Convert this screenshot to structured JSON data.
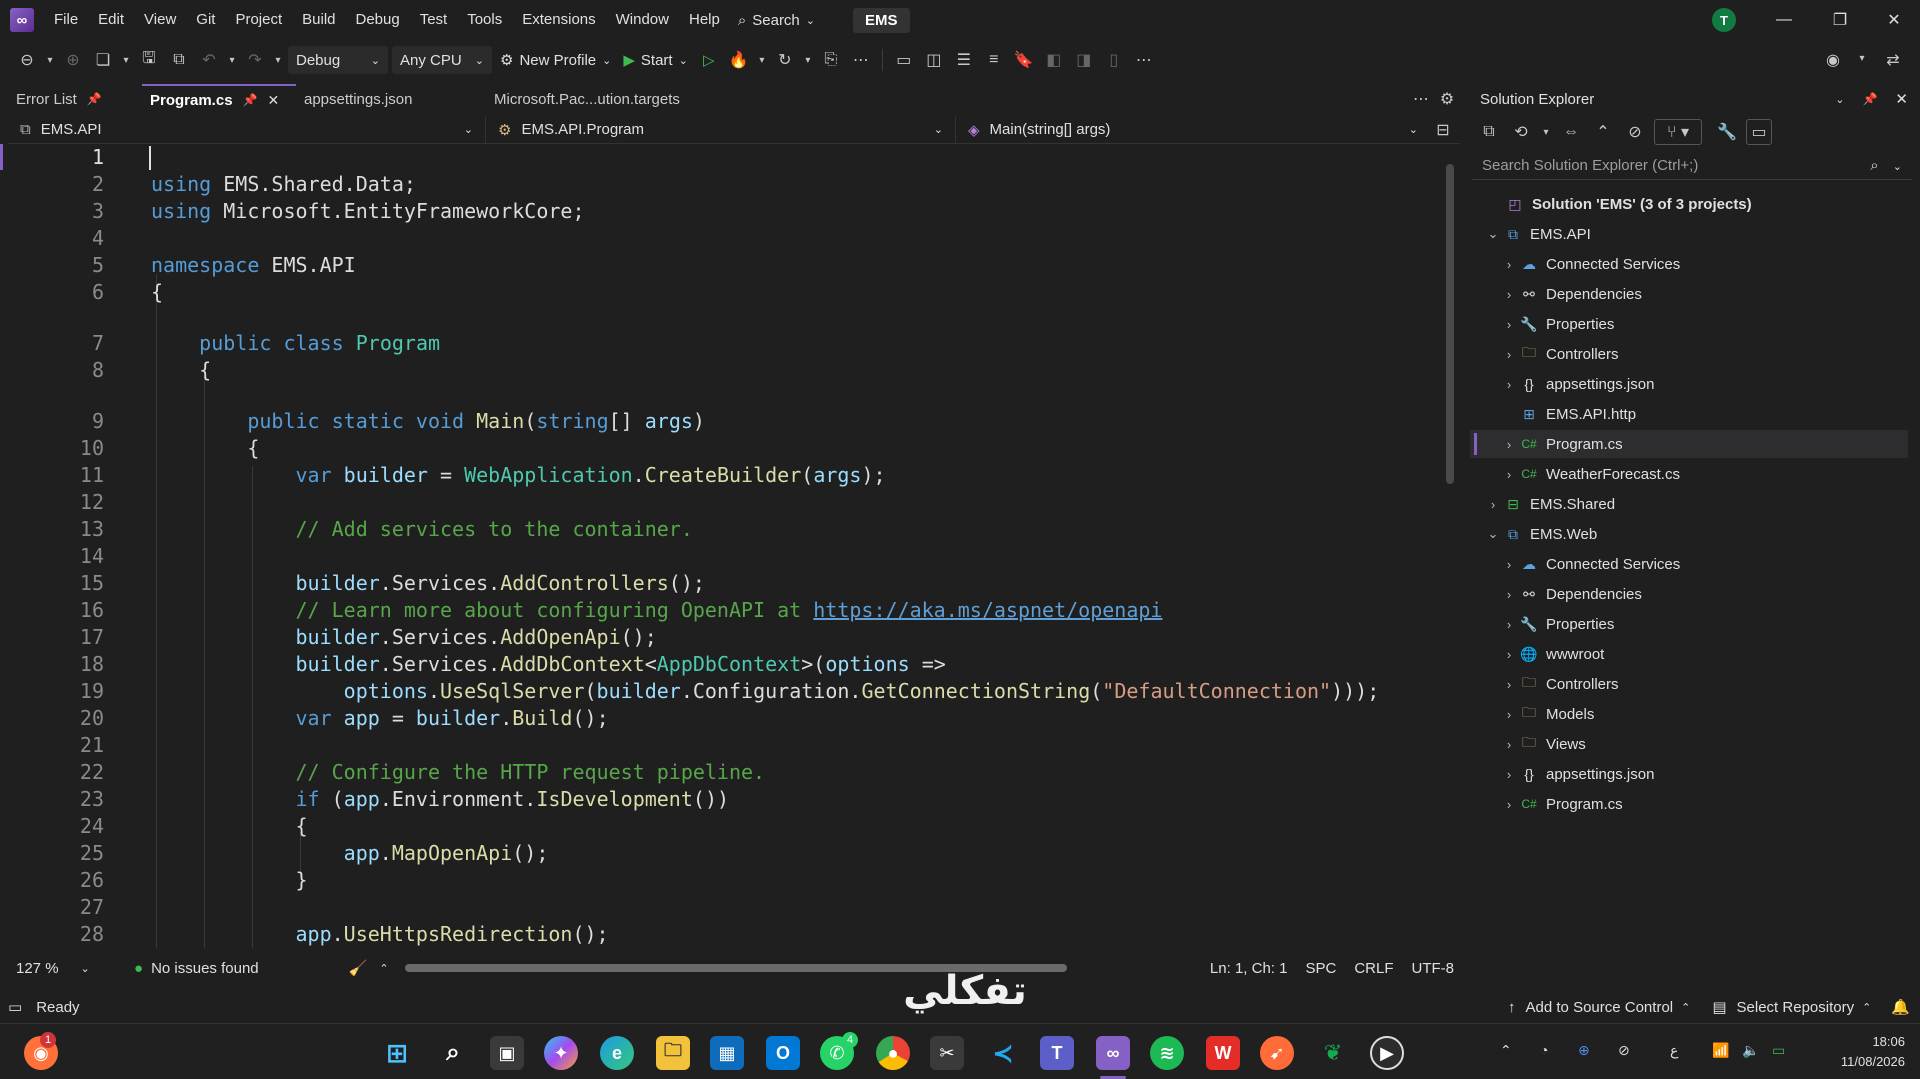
{
  "menubar": {
    "items": [
      "File",
      "Edit",
      "View",
      "Git",
      "Project",
      "Build",
      "Debug",
      "Test",
      "Tools",
      "Extensions",
      "Window",
      "Help"
    ],
    "search_label": "Search",
    "solution_name": "EMS",
    "avatar_initial": "T"
  },
  "toolbar": {
    "config": "Debug",
    "platform": "Any CPU",
    "profile": "New Profile",
    "start": "Start"
  },
  "tabs": {
    "error_list": "Error List",
    "program_cs": "Program.cs",
    "appsettings": "appsettings.json",
    "targets": "Microsoft.Pac...ution.targets"
  },
  "navbar": {
    "project": "EMS.API",
    "class": "EMS.API.Program",
    "member": "Main(string[] args)"
  },
  "editor": {
    "current_line": 1,
    "line_numbers": [
      "1",
      "2",
      "3",
      "4",
      "5",
      "6",
      "7",
      "8",
      "9",
      "10",
      "11",
      "12",
      "13",
      "14",
      "15",
      "16",
      "17",
      "18",
      "19",
      "20",
      "21",
      "22",
      "23",
      "24",
      "25",
      "26",
      "27",
      "28"
    ]
  },
  "editor_status": {
    "zoom": "127 %",
    "issues": "No issues found",
    "position": "Ln: 1, Ch: 1",
    "whitespace": "SPC",
    "line_endings": "CRLF",
    "encoding": "UTF-8"
  },
  "solution_explorer": {
    "title": "Solution Explorer",
    "search_placeholder": "Search Solution Explorer (Ctrl+;)",
    "solution_label": "Solution 'EMS' (3 of 3 projects)",
    "items": [
      {
        "label": "EMS.API",
        "icon": "project-icon"
      },
      {
        "label": "Connected Services",
        "icon": "connected-services-icon"
      },
      {
        "label": "Dependencies",
        "icon": "dependencies-icon"
      },
      {
        "label": "Properties",
        "icon": "properties-icon"
      },
      {
        "label": "Controllers",
        "icon": "folder-icon"
      },
      {
        "label": "appsettings.json",
        "icon": "json-file-icon"
      },
      {
        "label": "EMS.API.http",
        "icon": "http-file-icon"
      },
      {
        "label": "Program.cs",
        "icon": "csharp-file-icon"
      },
      {
        "label": "WeatherForecast.cs",
        "icon": "csharp-file-icon"
      },
      {
        "label": "EMS.Shared",
        "icon": "project-icon"
      },
      {
        "label": "EMS.Web",
        "icon": "project-icon"
      },
      {
        "label": "Connected Services",
        "icon": "connected-services-icon"
      },
      {
        "label": "Dependencies",
        "icon": "dependencies-icon"
      },
      {
        "label": "Properties",
        "icon": "properties-icon"
      },
      {
        "label": "wwwroot",
        "icon": "globe-icon"
      },
      {
        "label": "Controllers",
        "icon": "folder-icon"
      },
      {
        "label": "Models",
        "icon": "folder-icon"
      },
      {
        "label": "Views",
        "icon": "folder-icon"
      },
      {
        "label": "appsettings.json",
        "icon": "json-file-icon"
      },
      {
        "label": "Program.cs",
        "icon": "csharp-file-icon"
      }
    ]
  },
  "status_bar": {
    "ready": "Ready",
    "source_control": "Add to Source Control",
    "repository": "Select Repository"
  },
  "taskbar": {
    "notification_badge": "1",
    "whatsapp_badge": "4",
    "time": "18:06",
    "date": "11/08/2026",
    "tray_lang": "ع"
  },
  "watermark": "تفكلي",
  "colors": {
    "accent": "#8661c5",
    "keyword": "#569cd6",
    "type": "#4ec9b0",
    "method": "#dcdcaa",
    "identifier": "#9cdcfe",
    "comment": "#57a64a",
    "string": "#d69d85"
  }
}
